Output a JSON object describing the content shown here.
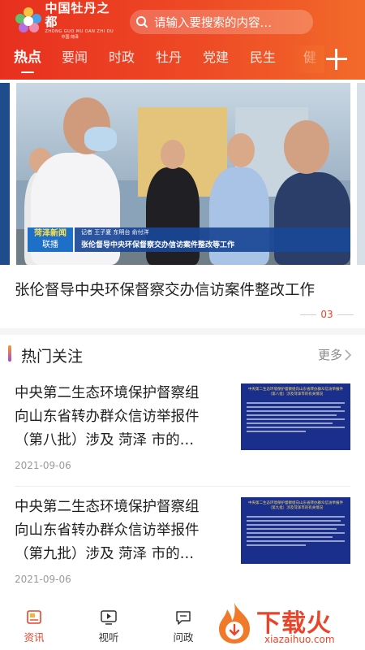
{
  "app": {
    "logo_text": "中国牡丹之都",
    "logo_pinyin": "ZHONG GUO MU DAN ZHI DU",
    "logo_sub": "中国·菏泽"
  },
  "search": {
    "placeholder": "请输入要搜索的内容…"
  },
  "tabs": [
    {
      "label": "热点",
      "active": true
    },
    {
      "label": "要闻",
      "active": false
    },
    {
      "label": "时政",
      "active": false
    },
    {
      "label": "牡丹",
      "active": false
    },
    {
      "label": "党建",
      "active": false
    },
    {
      "label": "民生",
      "active": false
    },
    {
      "label": "健",
      "active": false
    }
  ],
  "banner": {
    "tag_line1": "菏泽新闻",
    "tag_line2": "联播",
    "meta": "记者 王子夏 东明台 俞付洋",
    "caption": "张伦督导中央环保督察交办信访案件整改等工作",
    "headline": "张伦督导中央环保督察交办信访案件整改工作",
    "page_num": "03"
  },
  "section": {
    "title": "热门关注",
    "more": "更多"
  },
  "news": [
    {
      "line1": "中央第二生态环境保护督察组",
      "line2": "向山东省转办群众信访举报件",
      "line3": "（第八批）涉及 菏泽 市的…",
      "date": "2021-09-06",
      "thumb_title": "中央第二生态环境保护督察组向山东省转办群众信访举报件（第八批）涉及菏泽市的有关情况"
    },
    {
      "line1": "中央第二生态环境保护督察组",
      "line2": "向山东省转办群众信访举报件",
      "line3": "（第九批）涉及 菏泽 市的…",
      "date": "2021-09-06",
      "thumb_title": "中央第二生态环境保护督察组向山东省转办群众信访举报件（第九批）涉及菏泽市的有关情况"
    }
  ],
  "bottom_nav": [
    {
      "label": "资讯",
      "active": true
    },
    {
      "label": "视听",
      "active": false
    },
    {
      "label": "问政",
      "active": false
    }
  ],
  "watermark": {
    "text": "下载火",
    "url": "xiazaihuo.com"
  },
  "colors": {
    "brand": "#e8452a",
    "header_start": "#e8301f",
    "header_end": "#f26a2a",
    "thumb_bg": "#1a2f8c"
  }
}
